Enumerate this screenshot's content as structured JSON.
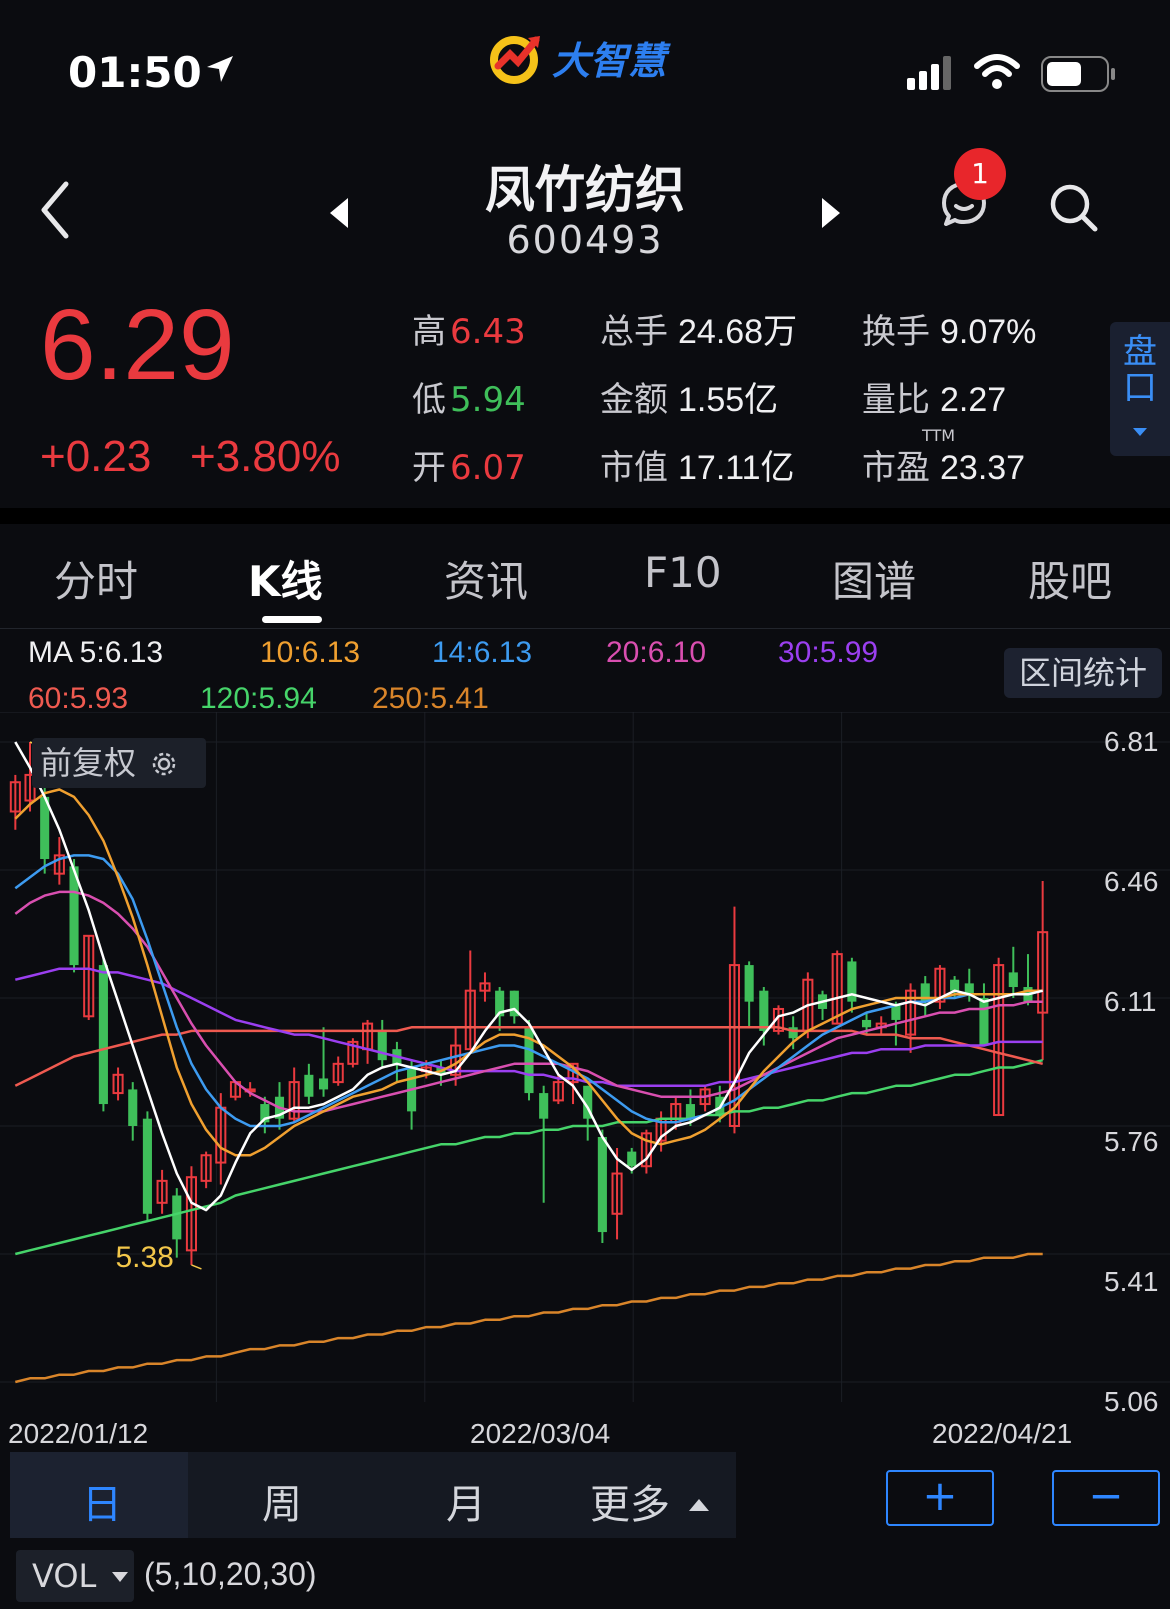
{
  "status_bar": {
    "time": "01:50"
  },
  "app": {
    "logo_text": "大智慧"
  },
  "header": {
    "stock_name": "凤竹纺织",
    "stock_code": "600493",
    "notification_count": "1"
  },
  "quote": {
    "price": "6.29",
    "change": "+0.23",
    "change_pct": "+3.80%",
    "high_label": "高",
    "high": "6.43",
    "low_label": "低",
    "low": "5.94",
    "open_label": "开",
    "open": "6.07",
    "volume_label": "总手",
    "volume": "24.68万",
    "amount_label": "金额",
    "amount": "1.55亿",
    "mktcap_label": "市值",
    "mktcap": "17.11亿",
    "turnover_label": "换手",
    "turnover": "9.07%",
    "vol_ratio_label": "量比",
    "vol_ratio": "2.27",
    "pe_label": "市盈",
    "pe_sup": "TTM",
    "pe": "23.37",
    "panel_button_line1": "盘",
    "panel_button_line2": "口"
  },
  "tabs": [
    {
      "label": "分时",
      "active": false
    },
    {
      "label": "K线",
      "active": true
    },
    {
      "label": "资讯",
      "active": false
    },
    {
      "label": "F10",
      "active": false
    },
    {
      "label": "图谱",
      "active": false
    },
    {
      "label": "股吧",
      "active": false
    }
  ],
  "ma_legend": {
    "ma5": "MA 5:6.13",
    "ma10": "10:6.13",
    "ma14": "14:6.13",
    "ma20": "20:6.10",
    "ma30": "30:5.99",
    "ma60": "60:5.93",
    "ma120": "120:5.94",
    "ma250": "250:5.41",
    "range_stats_button": "区间统计",
    "adjust_button": "前复权"
  },
  "colors": {
    "up": "#ea3a3f",
    "down": "#3fbf5a",
    "ma5": "#ffffff",
    "ma10": "#f0a030",
    "ma14": "#3d9bf0",
    "ma20": "#d94fb0",
    "ma30": "#9b3ff0",
    "ma60": "#ef5a50",
    "ma120": "#46d46a",
    "ma250": "#d9852a",
    "accent": "#2e86ff"
  },
  "chart_data": {
    "type": "candlestick",
    "y_axis_ticks": [
      "6.81",
      "6.46",
      "6.11",
      "5.76",
      "5.41",
      "5.06"
    ],
    "ylim": [
      5.06,
      6.81
    ],
    "x_axis_ticks": [
      "2022/01/12",
      "2022/03/04",
      "2022/04/21"
    ],
    "annotations": {
      "period_high": "6.81",
      "period_low": "5.38"
    },
    "candles": [
      {
        "o": 6.62,
        "c": 6.7,
        "h": 6.72,
        "l": 6.57
      },
      {
        "o": 6.65,
        "c": 6.72,
        "h": 6.81,
        "l": 6.62
      },
      {
        "o": 6.66,
        "c": 6.49,
        "h": 6.69,
        "l": 6.45
      },
      {
        "o": 6.45,
        "c": 6.5,
        "h": 6.55,
        "l": 6.42
      },
      {
        "o": 6.47,
        "c": 6.2,
        "h": 6.49,
        "l": 6.18
      },
      {
        "o": 6.06,
        "c": 6.28,
        "h": 6.28,
        "l": 6.05
      },
      {
        "o": 6.2,
        "c": 5.82,
        "h": 6.22,
        "l": 5.8
      },
      {
        "o": 5.85,
        "c": 5.9,
        "h": 5.92,
        "l": 5.83
      },
      {
        "o": 5.86,
        "c": 5.76,
        "h": 5.88,
        "l": 5.72
      },
      {
        "o": 5.78,
        "c": 5.52,
        "h": 5.8,
        "l": 5.5
      },
      {
        "o": 5.55,
        "c": 5.61,
        "h": 5.64,
        "l": 5.52
      },
      {
        "o": 5.57,
        "c": 5.45,
        "h": 5.59,
        "l": 5.4
      },
      {
        "o": 5.42,
        "c": 5.62,
        "h": 5.65,
        "l": 5.38
      },
      {
        "o": 5.61,
        "c": 5.68,
        "h": 5.69,
        "l": 5.59
      },
      {
        "o": 5.66,
        "c": 5.81,
        "h": 5.85,
        "l": 5.6
      },
      {
        "o": 5.84,
        "c": 5.88,
        "h": 5.88,
        "l": 5.83
      },
      {
        "o": 5.86,
        "c": 5.86,
        "h": 5.88,
        "l": 5.84
      },
      {
        "o": 5.82,
        "c": 5.77,
        "h": 5.84,
        "l": 5.74
      },
      {
        "o": 5.84,
        "c": 5.78,
        "h": 5.88,
        "l": 5.75
      },
      {
        "o": 5.78,
        "c": 5.88,
        "h": 5.92,
        "l": 5.77
      },
      {
        "o": 5.9,
        "c": 5.84,
        "h": 5.93,
        "l": 5.82
      },
      {
        "o": 5.89,
        "c": 5.86,
        "h": 6.03,
        "l": 5.84
      },
      {
        "o": 5.88,
        "c": 5.93,
        "h": 5.95,
        "l": 5.87
      },
      {
        "o": 5.93,
        "c": 5.99,
        "h": 6.0,
        "l": 5.92
      },
      {
        "o": 5.97,
        "c": 6.04,
        "h": 6.05,
        "l": 5.93
      },
      {
        "o": 6.02,
        "c": 5.94,
        "h": 6.05,
        "l": 5.92
      },
      {
        "o": 5.97,
        "c": 5.93,
        "h": 5.99,
        "l": 5.88
      },
      {
        "o": 5.92,
        "c": 5.8,
        "h": 5.94,
        "l": 5.75
      },
      {
        "o": 5.91,
        "c": 5.92,
        "h": 5.94,
        "l": 5.89
      },
      {
        "o": 5.92,
        "c": 5.9,
        "h": 5.94,
        "l": 5.87
      },
      {
        "o": 5.9,
        "c": 5.98,
        "h": 6.03,
        "l": 5.87
      },
      {
        "o": 5.97,
        "c": 6.13,
        "h": 6.24,
        "l": 5.97
      },
      {
        "o": 6.13,
        "c": 6.15,
        "h": 6.18,
        "l": 6.1
      },
      {
        "o": 6.13,
        "c": 6.06,
        "h": 6.14,
        "l": 6.02
      },
      {
        "o": 6.13,
        "c": 6.06,
        "h": 6.13,
        "l": 6.04
      },
      {
        "o": 6.03,
        "c": 5.85,
        "h": 6.05,
        "l": 5.83
      },
      {
        "o": 5.85,
        "c": 5.78,
        "h": 5.87,
        "l": 5.55
      },
      {
        "o": 5.83,
        "c": 5.88,
        "h": 5.9,
        "l": 5.82
      },
      {
        "o": 5.88,
        "c": 5.93,
        "h": 5.93,
        "l": 5.82
      },
      {
        "o": 5.87,
        "c": 5.78,
        "h": 5.87,
        "l": 5.72
      },
      {
        "o": 5.73,
        "c": 5.47,
        "h": 5.75,
        "l": 5.44
      },
      {
        "o": 5.52,
        "c": 5.63,
        "h": 5.7,
        "l": 5.45
      },
      {
        "o": 5.69,
        "c": 5.65,
        "h": 5.7,
        "l": 5.63
      },
      {
        "o": 5.65,
        "c": 5.74,
        "h": 5.75,
        "l": 5.63
      },
      {
        "o": 5.72,
        "c": 5.78,
        "h": 5.8,
        "l": 5.69
      },
      {
        "o": 5.77,
        "c": 5.82,
        "h": 5.84,
        "l": 5.75
      },
      {
        "o": 5.82,
        "c": 5.78,
        "h": 5.86,
        "l": 5.76
      },
      {
        "o": 5.82,
        "c": 5.86,
        "h": 5.87,
        "l": 5.8
      },
      {
        "o": 5.84,
        "c": 5.79,
        "h": 5.87,
        "l": 5.77
      },
      {
        "o": 5.76,
        "c": 6.2,
        "h": 6.36,
        "l": 5.74
      },
      {
        "o": 6.2,
        "c": 6.1,
        "h": 6.21,
        "l": 6.03
      },
      {
        "o": 6.13,
        "c": 6.02,
        "h": 6.14,
        "l": 5.98
      },
      {
        "o": 6.02,
        "c": 6.08,
        "h": 6.09,
        "l": 6.01
      },
      {
        "o": 6.03,
        "c": 6.0,
        "h": 6.06,
        "l": 5.97
      },
      {
        "o": 6.02,
        "c": 6.16,
        "h": 6.18,
        "l": 6.0
      },
      {
        "o": 6.12,
        "c": 6.08,
        "h": 6.13,
        "l": 6.05
      },
      {
        "o": 6.04,
        "c": 6.23,
        "h": 6.24,
        "l": 6.04
      },
      {
        "o": 6.21,
        "c": 6.1,
        "h": 6.22,
        "l": 6.07
      },
      {
        "o": 6.05,
        "c": 6.03,
        "h": 6.07,
        "l": 6.01
      },
      {
        "o": 6.03,
        "c": 6.04,
        "h": 6.06,
        "l": 6.01
      },
      {
        "o": 6.09,
        "c": 6.05,
        "h": 6.1,
        "l": 5.98
      },
      {
        "o": 6.01,
        "c": 6.13,
        "h": 6.15,
        "l": 5.96
      },
      {
        "o": 6.15,
        "c": 6.1,
        "h": 6.17,
        "l": 6.06
      },
      {
        "o": 6.1,
        "c": 6.19,
        "h": 6.2,
        "l": 6.08
      },
      {
        "o": 6.16,
        "c": 6.13,
        "h": 6.17,
        "l": 6.11
      },
      {
        "o": 6.15,
        "c": 6.12,
        "h": 6.19,
        "l": 6.1
      },
      {
        "o": 6.11,
        "c": 5.98,
        "h": 6.15,
        "l": 5.98
      },
      {
        "o": 5.79,
        "c": 6.2,
        "h": 6.22,
        "l": 5.79
      },
      {
        "o": 6.18,
        "c": 6.14,
        "h": 6.25,
        "l": 6.11
      },
      {
        "o": 6.14,
        "c": 6.1,
        "h": 6.23,
        "l": 6.09
      },
      {
        "o": 6.07,
        "c": 6.29,
        "h": 6.43,
        "l": 5.94
      }
    ],
    "series": [
      {
        "name": "MA5",
        "values": [
          6.81,
          6.74,
          6.66,
          6.57,
          6.46,
          6.35,
          6.22,
          6.1,
          5.98,
          5.86,
          5.74,
          5.63,
          5.55,
          5.53,
          5.57,
          5.66,
          5.74,
          5.78,
          5.79,
          5.81,
          5.81,
          5.82,
          5.84,
          5.86,
          5.9,
          5.92,
          5.93,
          5.92,
          5.91,
          5.9,
          5.91,
          5.96,
          6.02,
          6.07,
          6.08,
          6.04,
          5.97,
          5.9,
          5.87,
          5.81,
          5.73,
          5.67,
          5.64,
          5.67,
          5.73,
          5.76,
          5.77,
          5.79,
          5.81,
          5.88,
          5.96,
          6.01,
          6.06,
          6.07,
          6.09,
          6.1,
          6.11,
          6.12,
          6.11,
          6.1,
          6.09,
          6.1,
          6.09,
          6.11,
          6.13,
          6.12,
          6.1,
          6.11,
          6.12,
          6.12,
          6.13
        ]
      },
      {
        "name": "MA10",
        "values": [
          6.6,
          6.64,
          6.67,
          6.68,
          6.66,
          6.61,
          6.54,
          6.44,
          6.33,
          6.2,
          6.06,
          5.92,
          5.82,
          5.75,
          5.7,
          5.68,
          5.68,
          5.7,
          5.73,
          5.76,
          5.78,
          5.8,
          5.82,
          5.84,
          5.85,
          5.86,
          5.88,
          5.89,
          5.9,
          5.91,
          5.93,
          5.96,
          5.99,
          6.01,
          6.01,
          6.0,
          5.98,
          5.95,
          5.92,
          5.88,
          5.83,
          5.78,
          5.74,
          5.72,
          5.71,
          5.72,
          5.73,
          5.75,
          5.78,
          5.81,
          5.86,
          5.91,
          5.95,
          5.99,
          6.02,
          6.04,
          6.06,
          6.08,
          6.09,
          6.1,
          6.11,
          6.11,
          6.11,
          6.11,
          6.12,
          6.12,
          6.12,
          6.12,
          6.12,
          6.13,
          6.13
        ]
      },
      {
        "name": "MA14",
        "values": [
          6.41,
          6.44,
          6.47,
          6.49,
          6.5,
          6.5,
          6.49,
          6.45,
          6.38,
          6.27,
          6.15,
          6.03,
          5.93,
          5.86,
          5.81,
          5.78,
          5.76,
          5.76,
          5.76,
          5.77,
          5.79,
          5.81,
          5.83,
          5.85,
          5.87,
          5.89,
          5.91,
          5.92,
          5.93,
          5.94,
          5.95,
          5.96,
          5.97,
          5.98,
          5.98,
          5.97,
          5.95,
          5.93,
          5.91,
          5.89,
          5.86,
          5.83,
          5.8,
          5.78,
          5.77,
          5.77,
          5.78,
          5.79,
          5.81,
          5.83,
          5.86,
          5.89,
          5.92,
          5.95,
          5.98,
          6.01,
          6.03,
          6.05,
          6.07,
          6.08,
          6.09,
          6.1,
          6.1,
          6.11,
          6.11,
          6.12,
          6.12,
          6.12,
          6.12,
          6.12,
          6.13
        ]
      },
      {
        "name": "MA20",
        "values": [
          6.34,
          6.37,
          6.39,
          6.4,
          6.4,
          6.39,
          6.37,
          6.34,
          6.3,
          6.25,
          6.18,
          6.11,
          6.04,
          5.98,
          5.93,
          5.88,
          5.85,
          5.83,
          5.81,
          5.8,
          5.8,
          5.8,
          5.81,
          5.82,
          5.83,
          5.84,
          5.85,
          5.86,
          5.87,
          5.88,
          5.89,
          5.9,
          5.91,
          5.92,
          5.93,
          5.93,
          5.93,
          5.93,
          5.92,
          5.91,
          5.89,
          5.87,
          5.86,
          5.85,
          5.84,
          5.84,
          5.84,
          5.84,
          5.85,
          5.86,
          5.88,
          5.9,
          5.92,
          5.94,
          5.96,
          5.98,
          6.0,
          6.01,
          6.02,
          6.03,
          6.04,
          6.05,
          6.06,
          6.07,
          6.07,
          6.08,
          6.08,
          6.09,
          6.09,
          6.1,
          6.1
        ]
      },
      {
        "name": "MA30",
        "values": [
          6.16,
          6.17,
          6.18,
          6.19,
          6.19,
          6.19,
          6.18,
          6.18,
          6.17,
          6.16,
          6.15,
          6.13,
          6.11,
          6.09,
          6.07,
          6.05,
          6.04,
          6.03,
          6.02,
          6.01,
          6.01,
          6.0,
          5.99,
          5.98,
          5.97,
          5.96,
          5.95,
          5.94,
          5.93,
          5.92,
          5.91,
          5.91,
          5.91,
          5.91,
          5.91,
          5.9,
          5.9,
          5.89,
          5.89,
          5.88,
          5.88,
          5.87,
          5.87,
          5.87,
          5.87,
          5.87,
          5.87,
          5.87,
          5.88,
          5.88,
          5.89,
          5.9,
          5.91,
          5.92,
          5.93,
          5.94,
          5.95,
          5.96,
          5.96,
          5.97,
          5.97,
          5.97,
          5.98,
          5.98,
          5.98,
          5.98,
          5.98,
          5.99,
          5.99,
          5.99,
          5.99
        ]
      },
      {
        "name": "MA60",
        "values": [
          5.87,
          5.89,
          5.91,
          5.93,
          5.95,
          5.96,
          5.97,
          5.98,
          5.99,
          6.0,
          6.01,
          6.01,
          6.02,
          6.02,
          6.02,
          6.02,
          6.02,
          6.02,
          6.02,
          6.02,
          6.02,
          6.02,
          6.02,
          6.02,
          6.02,
          6.02,
          6.02,
          6.03,
          6.03,
          6.03,
          6.03,
          6.03,
          6.03,
          6.03,
          6.03,
          6.03,
          6.03,
          6.03,
          6.03,
          6.03,
          6.03,
          6.03,
          6.03,
          6.03,
          6.03,
          6.03,
          6.03,
          6.03,
          6.03,
          6.03,
          6.03,
          6.03,
          6.03,
          6.02,
          6.02,
          6.02,
          6.02,
          6.02,
          6.01,
          6.01,
          6.01,
          6.0,
          6.0,
          6.0,
          5.99,
          5.98,
          5.97,
          5.96,
          5.95,
          5.94,
          5.93
        ]
      },
      {
        "name": "MA120",
        "values": [
          5.41,
          5.42,
          5.43,
          5.44,
          5.45,
          5.46,
          5.47,
          5.48,
          5.49,
          5.5,
          5.51,
          5.52,
          5.53,
          5.54,
          5.55,
          5.57,
          5.58,
          5.59,
          5.6,
          5.61,
          5.62,
          5.63,
          5.64,
          5.65,
          5.66,
          5.67,
          5.68,
          5.69,
          5.7,
          5.71,
          5.71,
          5.72,
          5.73,
          5.73,
          5.74,
          5.74,
          5.75,
          5.75,
          5.76,
          5.76,
          5.76,
          5.77,
          5.77,
          5.77,
          5.78,
          5.78,
          5.78,
          5.79,
          5.79,
          5.8,
          5.8,
          5.81,
          5.81,
          5.82,
          5.83,
          5.83,
          5.84,
          5.85,
          5.85,
          5.86,
          5.87,
          5.87,
          5.88,
          5.89,
          5.9,
          5.9,
          5.91,
          5.92,
          5.92,
          5.93,
          5.94
        ]
      },
      {
        "name": "MA250",
        "values": [
          5.06,
          5.07,
          5.07,
          5.08,
          5.08,
          5.09,
          5.09,
          5.1,
          5.1,
          5.11,
          5.11,
          5.12,
          5.12,
          5.13,
          5.13,
          5.14,
          5.15,
          5.15,
          5.16,
          5.16,
          5.17,
          5.17,
          5.18,
          5.18,
          5.19,
          5.19,
          5.2,
          5.2,
          5.21,
          5.21,
          5.22,
          5.22,
          5.23,
          5.23,
          5.24,
          5.24,
          5.25,
          5.25,
          5.26,
          5.26,
          5.27,
          5.27,
          5.28,
          5.28,
          5.29,
          5.29,
          5.3,
          5.3,
          5.31,
          5.31,
          5.32,
          5.32,
          5.33,
          5.33,
          5.34,
          5.34,
          5.35,
          5.35,
          5.36,
          5.36,
          5.37,
          5.37,
          5.38,
          5.38,
          5.39,
          5.39,
          5.4,
          5.4,
          5.4,
          5.41,
          5.41
        ]
      }
    ]
  },
  "periods": {
    "day": "日",
    "week": "周",
    "month": "月",
    "more": "更多",
    "zoom_in": "+",
    "zoom_out": "−"
  },
  "volume": {
    "indicator": "VOL",
    "params": "(5,10,20,30)"
  }
}
